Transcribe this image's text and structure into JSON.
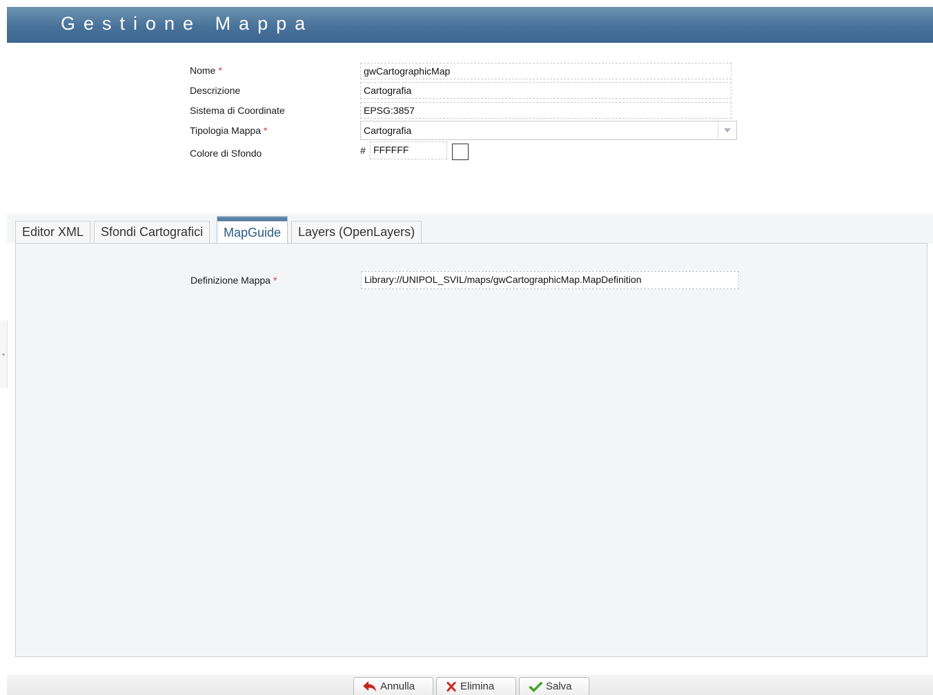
{
  "header": {
    "title": "Gestione Mappa"
  },
  "form": {
    "nome": {
      "label": "Nome",
      "required_mark": "*",
      "value": "gwCartographicMap"
    },
    "descrizione": {
      "label": "Descrizione",
      "value": "Cartografia"
    },
    "sistema": {
      "label": "Sistema di Coordinate",
      "value": "EPSG:3857"
    },
    "tipologia": {
      "label": "Tipologia Mappa",
      "required_mark": "*",
      "value": "Cartografia"
    },
    "colore": {
      "label": "Colore di Sfondo",
      "hash": "#",
      "value": "FFFFFF",
      "swatch_color": "#FFFFFF"
    }
  },
  "tabs": [
    {
      "label": "Editor XML",
      "active": false
    },
    {
      "label": "Sfondi Cartografici",
      "active": false
    },
    {
      "label": "MapGuide",
      "active": true
    },
    {
      "label": "Layers (OpenLayers)",
      "active": false
    }
  ],
  "mapguide": {
    "definizione": {
      "label": "Definizione Mappa",
      "required_mark": "*",
      "value": "Library://UNIPOL_SVIL/maps/gwCartographicMap.MapDefinition"
    }
  },
  "buttons": {
    "annulla": "Annulla",
    "elimina": "Elimina",
    "salva": "Salva"
  },
  "icons": {
    "annulla": "undo-arrow-icon",
    "elimina": "red-x-icon",
    "salva": "green-check-icon",
    "dropdown": "chevron-down-icon"
  },
  "colors": {
    "header": "#49729A",
    "required": "#D9342B",
    "active_tab_text": "#2C5A85"
  }
}
